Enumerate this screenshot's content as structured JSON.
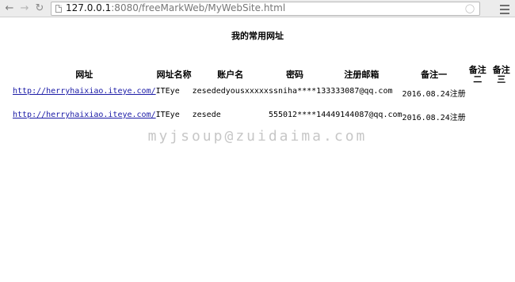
{
  "browser": {
    "url_host": "127.0.0.1",
    "url_rest": ":8080/freeMarkWeb/MyWebSite.html"
  },
  "page": {
    "title": "我的常用网址",
    "headers": [
      "网址",
      "网址名称",
      "账户名",
      "密码",
      "注册邮箱",
      "备注一",
      "备注二",
      "备注三"
    ],
    "rows": [
      {
        "site": "http://herryhaixiao.iteye.com/",
        "name": "ITEye",
        "account": "zesededyousxxxxx",
        "password": "ssniha****1",
        "email": "33333087@qq.com",
        "note1": "2016.08.24注册",
        "note2": "",
        "note3": ""
      },
      {
        "site": "http://herryhaixiao.iteye.com/",
        "name": "ITEye",
        "account": "zesede",
        "password": "555012****1",
        "email": "4449144087@qq.com",
        "note1": "2016.08.24注册",
        "note2": "",
        "note3": ""
      }
    ]
  },
  "watermark": "myjsoup@zuidaima.com"
}
